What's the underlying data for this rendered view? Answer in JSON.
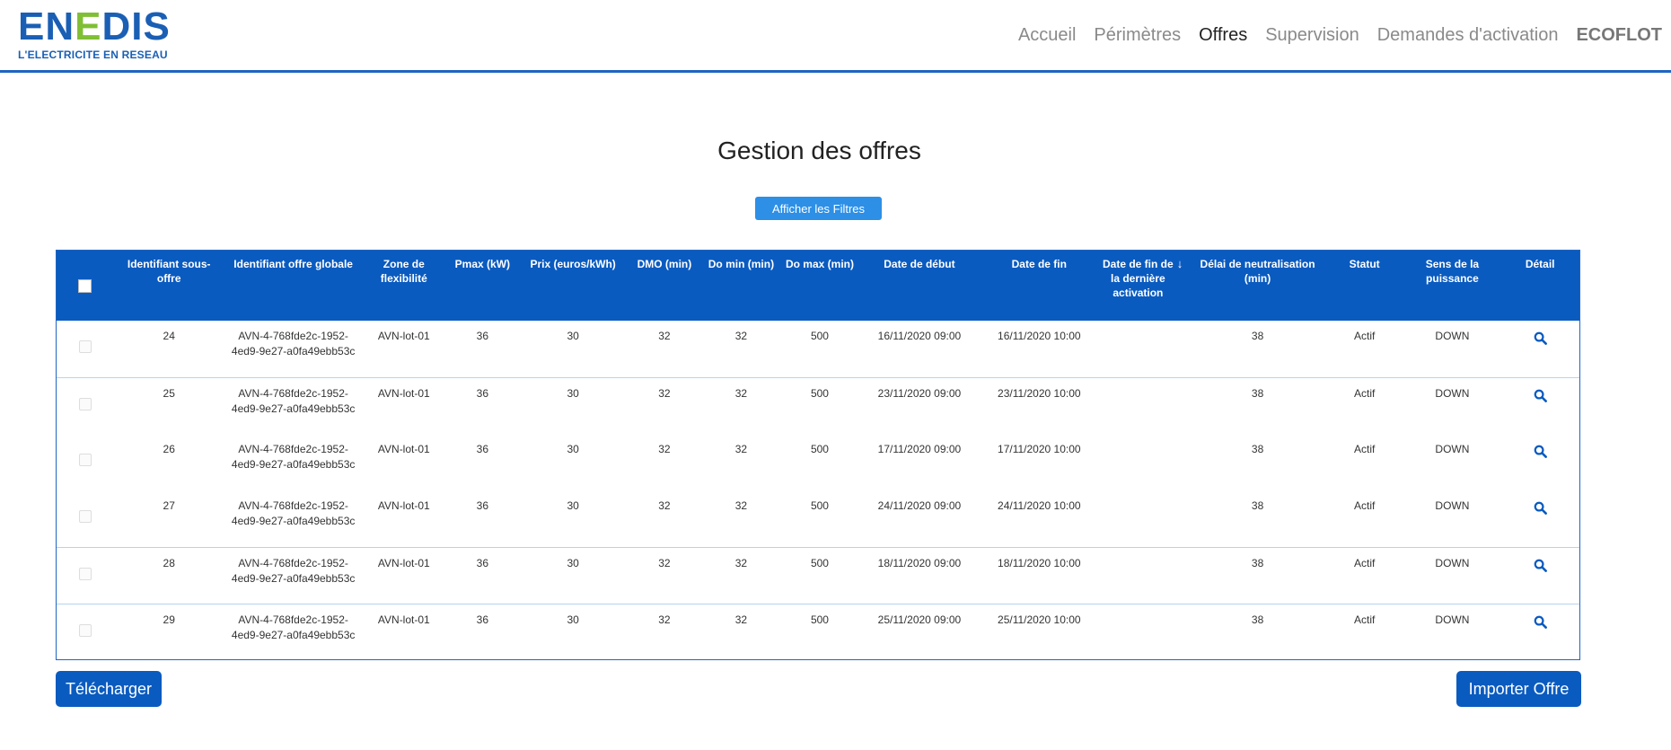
{
  "header": {
    "logo_word_a": "EN",
    "logo_word_b": "E",
    "logo_word_c": "DIS",
    "logo_tagline": "L'ELECTRICITE EN RESEAU",
    "nav": [
      {
        "label": "Accueil",
        "active": false
      },
      {
        "label": "Périmètres",
        "active": false
      },
      {
        "label": "Offres",
        "active": true
      },
      {
        "label": "Supervision",
        "active": false
      },
      {
        "label": "Demandes d'activation",
        "active": false
      },
      {
        "label": "ECOFLOT",
        "active": false
      }
    ]
  },
  "page": {
    "title": "Gestion des offres",
    "filter_button": "Afficher les Filtres"
  },
  "table": {
    "columns": [
      "Identifiant sous-offre",
      "Identifiant offre globale",
      "Zone de flexibilité",
      "Pmax (kW)",
      "Prix (euros/kWh)",
      "DMO (min)",
      "Do min (min)",
      "Do max (min)",
      "Date de début",
      "Date de fin",
      "Date de fin de la dernière activation",
      "Délai de neutralisation (min)",
      "Statut",
      "Sens de la puissance",
      "Détail"
    ],
    "sort_arrow": "↓",
    "rows": [
      {
        "id": "24",
        "global": "AVN-4-768fde2c-1952-4ed9-9e27-a0fa49ebb53c",
        "zone": "AVN-lot-01",
        "pmax": "36",
        "prix": "30",
        "dmo": "32",
        "domin": "32",
        "domax": "500",
        "debut": "16/11/2020 09:00",
        "fin": "16/11/2020 10:00",
        "derniere": "",
        "delai": "38",
        "statut": "Actif",
        "sens": "DOWN"
      },
      {
        "id": "25",
        "global": "AVN-4-768fde2c-1952-4ed9-9e27-a0fa49ebb53c",
        "zone": "AVN-lot-01",
        "pmax": "36",
        "prix": "30",
        "dmo": "32",
        "domin": "32",
        "domax": "500",
        "debut": "23/11/2020 09:00",
        "fin": "23/11/2020 10:00",
        "derniere": "",
        "delai": "38",
        "statut": "Actif",
        "sens": "DOWN"
      },
      {
        "id": "26",
        "global": "AVN-4-768fde2c-1952-4ed9-9e27-a0fa49ebb53c",
        "zone": "AVN-lot-01",
        "pmax": "36",
        "prix": "30",
        "dmo": "32",
        "domin": "32",
        "domax": "500",
        "debut": "17/11/2020 09:00",
        "fin": "17/11/2020 10:00",
        "derniere": "",
        "delai": "38",
        "statut": "Actif",
        "sens": "DOWN"
      },
      {
        "id": "27",
        "global": "AVN-4-768fde2c-1952-4ed9-9e27-a0fa49ebb53c",
        "zone": "AVN-lot-01",
        "pmax": "36",
        "prix": "30",
        "dmo": "32",
        "domin": "32",
        "domax": "500",
        "debut": "24/11/2020 09:00",
        "fin": "24/11/2020 10:00",
        "derniere": "",
        "delai": "38",
        "statut": "Actif",
        "sens": "DOWN"
      },
      {
        "id": "28",
        "global": "AVN-4-768fde2c-1952-4ed9-9e27-a0fa49ebb53c",
        "zone": "AVN-lot-01",
        "pmax": "36",
        "prix": "30",
        "dmo": "32",
        "domin": "32",
        "domax": "500",
        "debut": "18/11/2020 09:00",
        "fin": "18/11/2020 10:00",
        "derniere": "",
        "delai": "38",
        "statut": "Actif",
        "sens": "DOWN"
      },
      {
        "id": "29",
        "global": "AVN-4-768fde2c-1952-4ed9-9e27-a0fa49ebb53c",
        "zone": "AVN-lot-01",
        "pmax": "36",
        "prix": "30",
        "dmo": "32",
        "domin": "32",
        "domax": "500",
        "debut": "25/11/2020 09:00",
        "fin": "25/11/2020 10:00",
        "derniere": "",
        "delai": "38",
        "statut": "Actif",
        "sens": "DOWN"
      }
    ]
  },
  "actions": {
    "download": "Télécharger",
    "import": "Importer Offre"
  },
  "colors": {
    "primary": "#0a5bc0",
    "filter_button": "#2d8fe6",
    "logo_blue": "#1a5fb4",
    "logo_green": "#7fbf34"
  },
  "icons": {
    "detail": "search-icon"
  }
}
